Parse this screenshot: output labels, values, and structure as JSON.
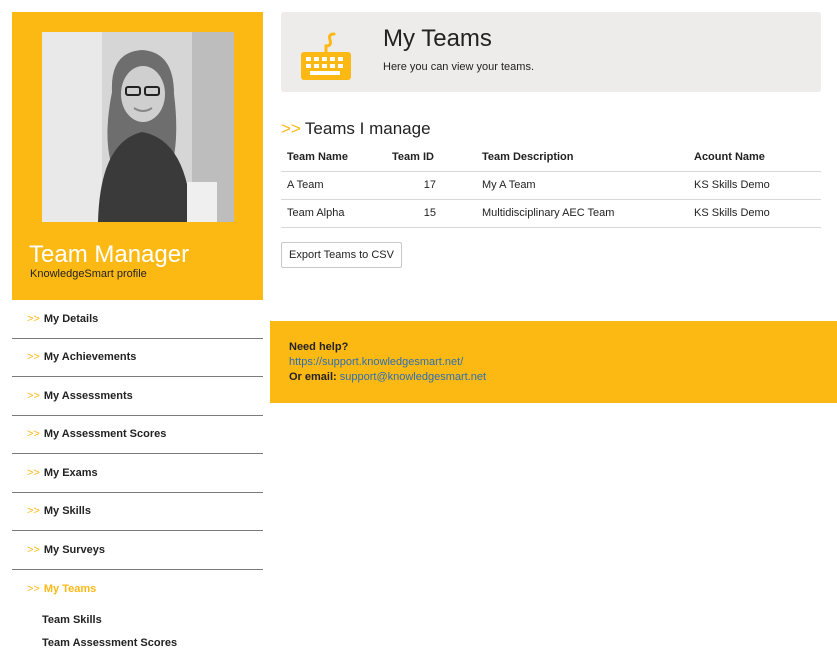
{
  "profile": {
    "name": "Team Manager",
    "subtitle": "KnowledgeSmart profile"
  },
  "nav_prefix": ">>",
  "nav": {
    "items": [
      {
        "label": "My Details"
      },
      {
        "label": "My Achievements"
      },
      {
        "label": "My Assessments"
      },
      {
        "label": "My Assessment Scores"
      },
      {
        "label": "My Exams"
      },
      {
        "label": "My Skills"
      },
      {
        "label": "My Surveys"
      },
      {
        "label": "My Teams"
      }
    ],
    "subitems": [
      {
        "label": "Team Skills"
      },
      {
        "label": "Team Assessment Scores"
      }
    ],
    "active": "My Teams"
  },
  "header": {
    "icon": "keyboard-icon",
    "title": "My Teams",
    "subtitle": "Here you can view your teams."
  },
  "section": {
    "title": "Teams I manage"
  },
  "table": {
    "headers": [
      "Team Name",
      "Team ID",
      "Team Description",
      "Acount Name"
    ],
    "rows": [
      [
        "A Team",
        "17",
        "My A Team",
        "KS Skills Demo"
      ],
      [
        "Team Alpha",
        "15",
        "Multidisciplinary AEC Team",
        "KS Skills Demo"
      ]
    ]
  },
  "export_button": "Export Teams to CSV",
  "help": {
    "heading": "Need help?",
    "link": "https://support.knowledgesmart.net/",
    "email_label": "Or email:",
    "email": "support@knowledgesmart.net"
  },
  "colors": {
    "accent": "#fdb913",
    "header_bg": "#eeeceb",
    "link": "#2a6fb5"
  }
}
